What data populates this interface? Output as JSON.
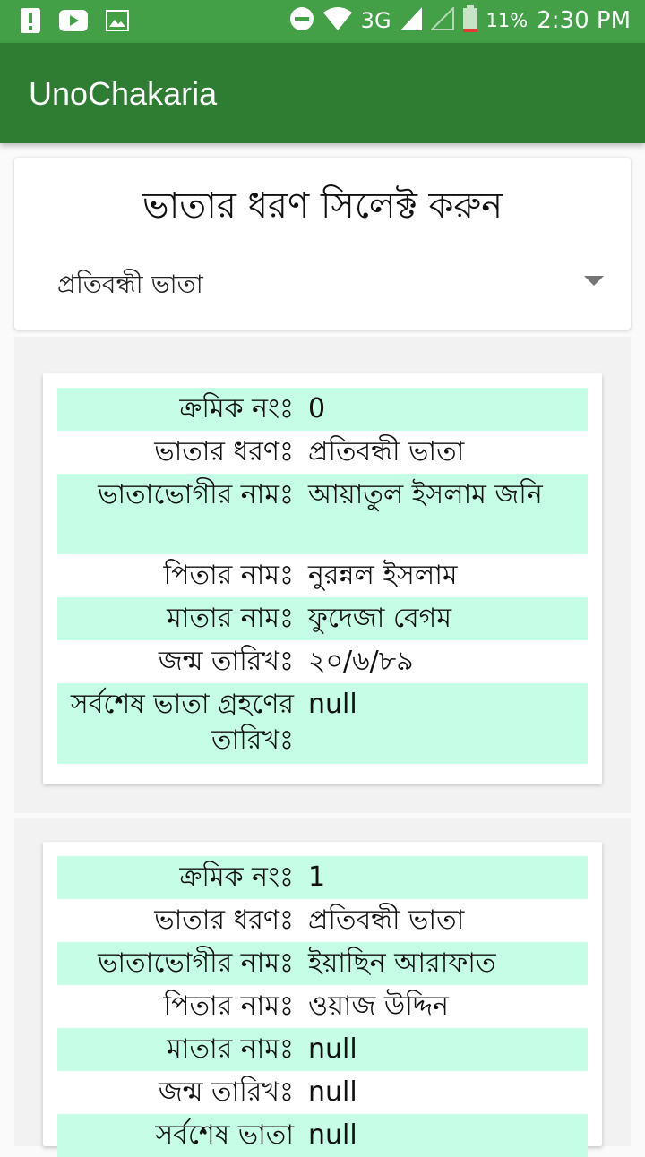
{
  "status_bar": {
    "network": "3G",
    "battery": "11%",
    "time": "2:30 PM"
  },
  "app_bar": {
    "title": "UnoChakaria"
  },
  "selector": {
    "heading": "ভাতার ধরণ সিলেক্ট করুন",
    "selected_value": "প্রতিবন্ধী ভাতা"
  },
  "records": [
    {
      "rows": [
        {
          "label": "ক্রমিক নংঃ",
          "value": "0"
        },
        {
          "label": "ভাতার ধরণঃ",
          "value": "প্রতিবন্ধী ভাতা"
        },
        {
          "label": "ভাতাভোগীর নামঃ",
          "value": "আয়াতুল ইসলাম জনি"
        },
        {
          "label": "পিতার নামঃ",
          "value": "নুরন্নল ইসলাম"
        },
        {
          "label": "মাতার নামঃ",
          "value": "ফুদেজা বেগম"
        },
        {
          "label": "জন্ম তারিখঃ",
          "value": "২০/৬/৮৯"
        },
        {
          "label": "সর্বশেষ ভাতা গ্রহণের তারিখঃ",
          "value": "null"
        }
      ]
    },
    {
      "rows": [
        {
          "label": "ক্রমিক নংঃ",
          "value": "1"
        },
        {
          "label": "ভাতার ধরণঃ",
          "value": "প্রতিবন্ধী ভাতা"
        },
        {
          "label": "ভাতাভোগীর নামঃ",
          "value": "ইয়াছিন আরাফাত"
        },
        {
          "label": "পিতার নামঃ",
          "value": "ওয়াজ উদ্দিন"
        },
        {
          "label": "মাতার নামঃ",
          "value": "null"
        },
        {
          "label": "জন্ম তারিখঃ",
          "value": "null"
        },
        {
          "label": "সর্বশেষ ভাতা",
          "value": "null"
        }
      ]
    }
  ],
  "colors": {
    "status_bar": "#43a047",
    "app_bar": "#2e7d32",
    "row_highlight": "#c5fde6",
    "dropdown_arrow": "#757575"
  }
}
